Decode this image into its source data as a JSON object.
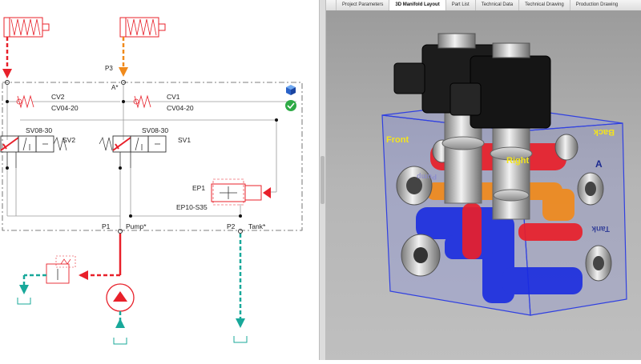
{
  "schematic": {
    "port_p3": "P3",
    "port_a": "A*",
    "port_p1": "P1",
    "port_pump": "Pump*",
    "port_p2": "P2",
    "port_tank": "Tank*",
    "cv2": "CV2",
    "cv2_model": "CV04-20",
    "cv1": "CV1",
    "cv1_model": "CV04-20",
    "sv2_model": "SV08-30",
    "sv2": "SV2",
    "sv1_model": "SV08-30",
    "sv1": "SV1",
    "ep1": "EP1",
    "ep1_model": "EP10-S35"
  },
  "tabs": [
    {
      "label": "Project Parameters"
    },
    {
      "label": "3D Manifold Layout"
    },
    {
      "label": "Part List"
    },
    {
      "label": "Technical Data"
    },
    {
      "label": "Technical Drawing"
    },
    {
      "label": "Production Drawing"
    }
  ],
  "active_tab": "3D Manifold Layout",
  "model_labels": {
    "front": "Front",
    "back": "Back",
    "right": "Right",
    "a": "A",
    "pump": "Pump",
    "tank": "Tank"
  },
  "colors": {
    "hydraulic_red": "#e8202a",
    "pilot_orange": "#f08a1c",
    "tank_teal": "#18a89a",
    "manifold_blue": "#1a2ce0",
    "label_yellow": "#f4e41c",
    "ok_green": "#2eaa46"
  }
}
